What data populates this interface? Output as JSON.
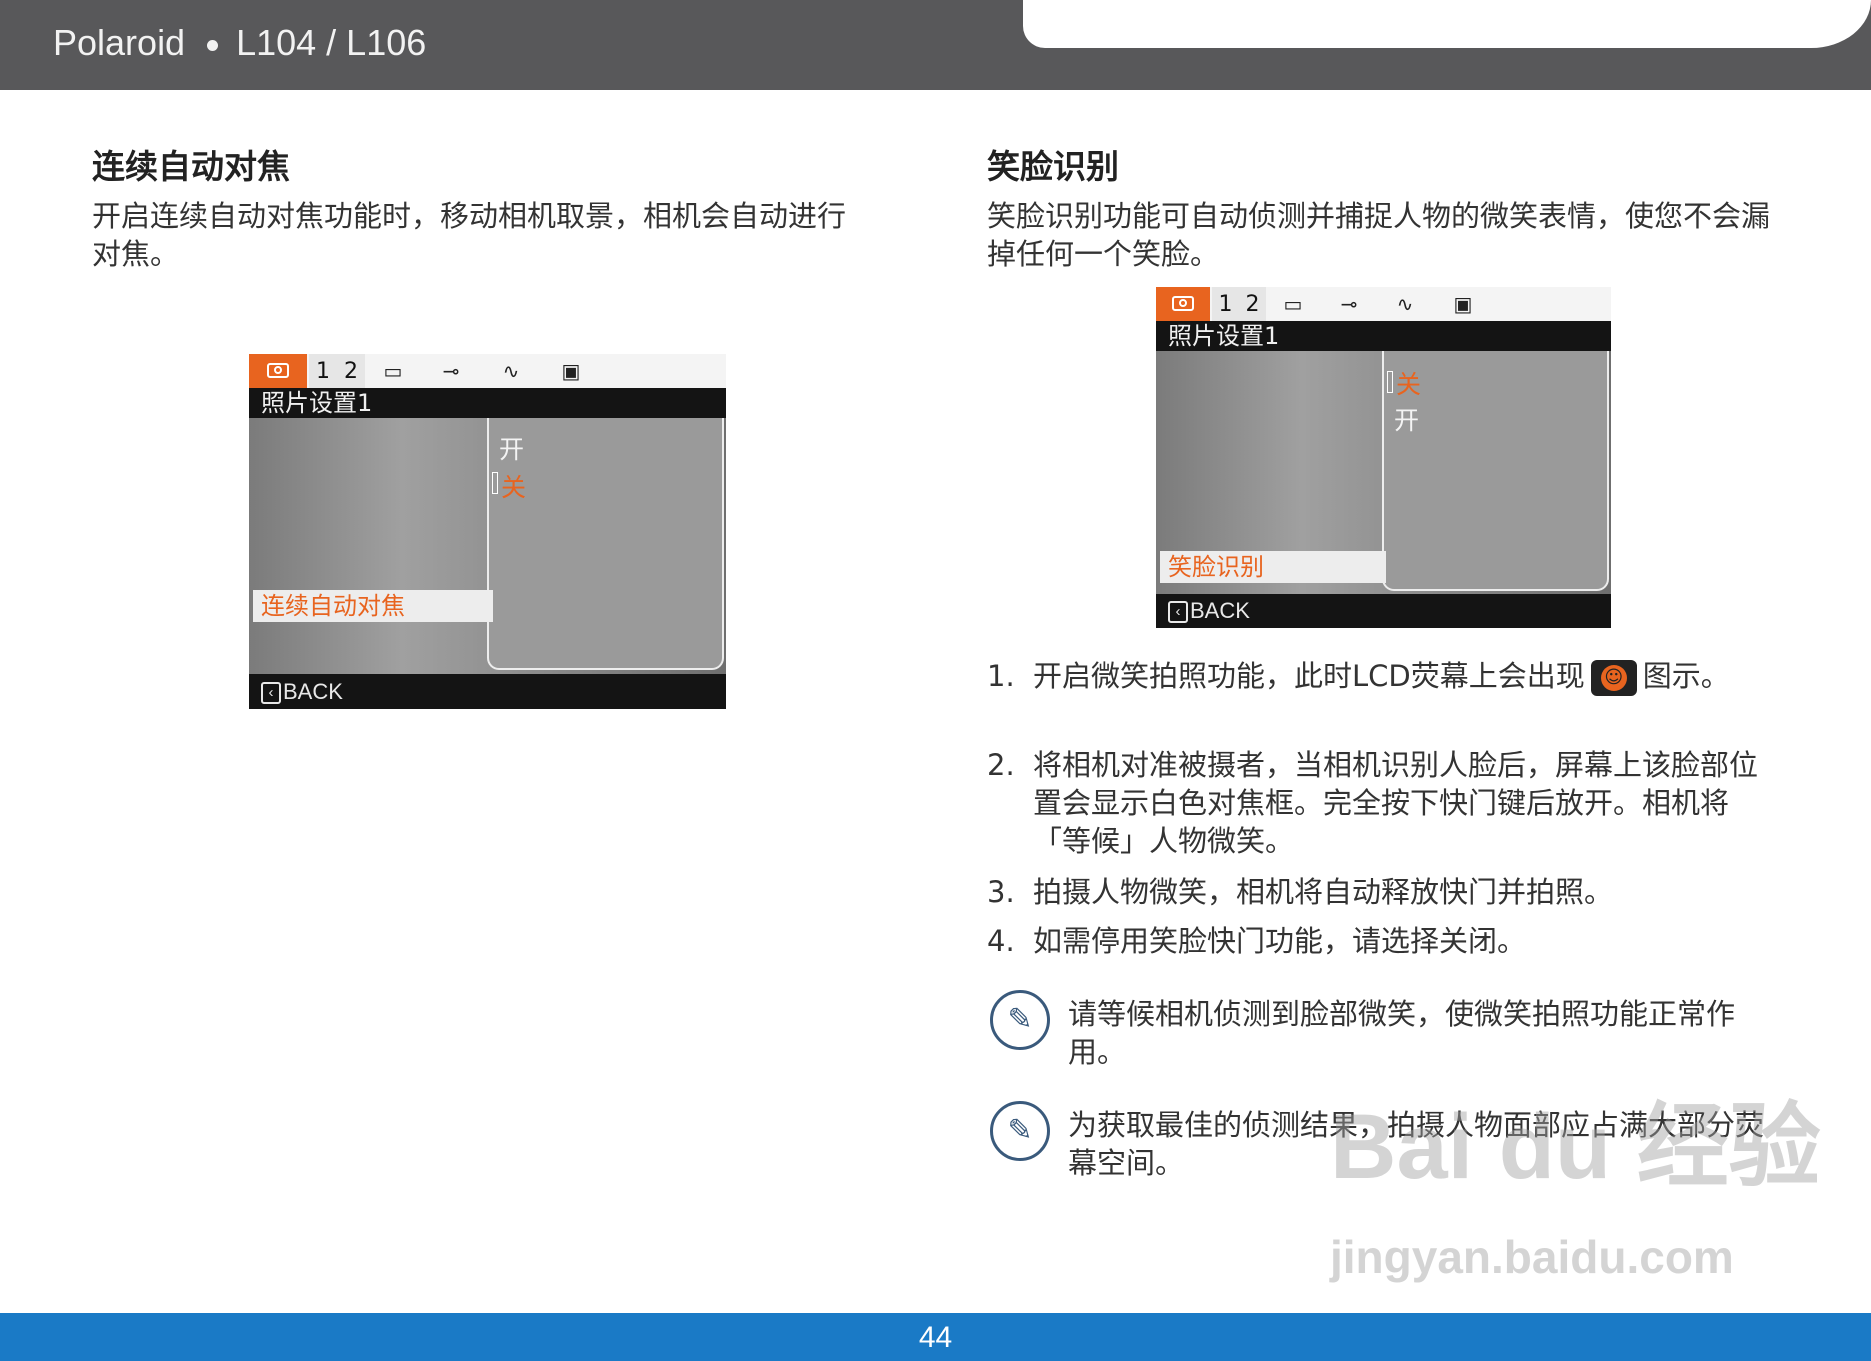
{
  "header": {
    "brand": "Polaroid",
    "model": "L104 / L106"
  },
  "footer": {
    "page_number": "44"
  },
  "left": {
    "title": "连续自动对焦",
    "body": "开启连续自动对焦功能时，移动相机取景，相机会自动进行对焦。",
    "screen": {
      "tab_numbers": [
        "1",
        "2"
      ],
      "title": "照片设置1",
      "options": [
        {
          "label": "开",
          "selected": false
        },
        {
          "label": "关",
          "selected": true
        }
      ],
      "menu_item": "连续自动对焦",
      "back": "BACK"
    }
  },
  "right": {
    "title": "笑脸识别",
    "body": "笑脸识别功能可自动侦测并捕捉人物的微笑表情，使您不会漏掉任何一个笑脸。",
    "screen": {
      "tab_numbers": [
        "1",
        "2"
      ],
      "title": "照片设置1",
      "options": [
        {
          "label": "关",
          "selected": true
        },
        {
          "label": "开",
          "selected": false
        }
      ],
      "menu_item": "笑脸识别",
      "back": "BACK"
    },
    "steps": [
      {
        "num": "1.",
        "text_before": "开启微笑拍照功能，此时LCD荧幕上会出现",
        "text_after": "图示。"
      },
      {
        "num": "2.",
        "text": "将相机对准被摄者，当相机识别人脸后，屏幕上该脸部位置会显示白色对焦框。完全按下快门键后放开。相机将「等候」人物微笑。"
      },
      {
        "num": "3.",
        "text": "拍摄人物微笑，相机将自动释放快门并拍照。"
      },
      {
        "num": "4.",
        "text": "如需停用笑脸快门功能，请选择关闭。"
      }
    ],
    "notes": [
      "请等候相机侦测到脸部微笑，使微笑拍照功能正常作用。",
      "为获取最佳的侦测结果，拍摄人物面部应占满大部分荧幕空间。"
    ]
  },
  "watermark": {
    "line1": "Bai du 经验",
    "line2": "jingyan.baidu.com"
  }
}
